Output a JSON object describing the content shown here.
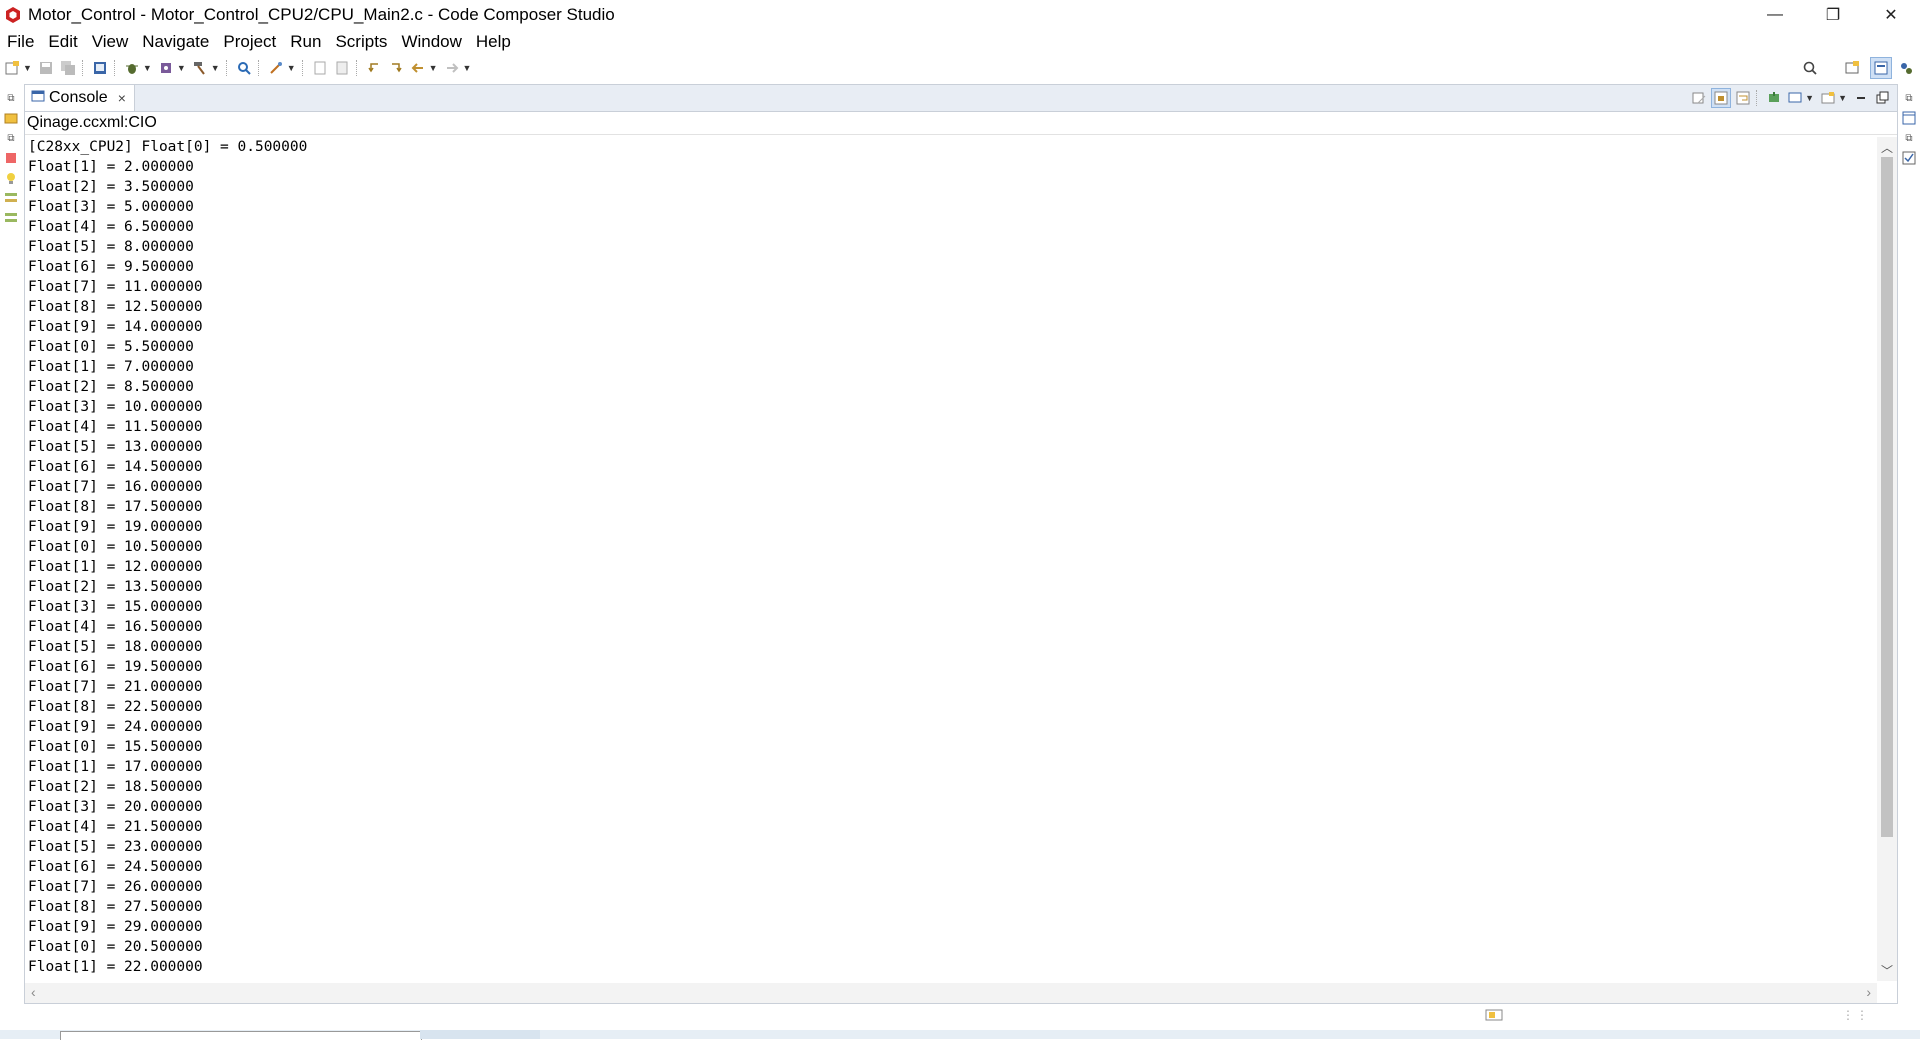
{
  "window": {
    "title": "Motor_Control - Motor_Control_CPU2/CPU_Main2.c - Code Composer Studio",
    "minimize": "—",
    "restore": "❐",
    "close": "✕"
  },
  "menu": [
    {
      "label": "File"
    },
    {
      "label": "Edit"
    },
    {
      "label": "View"
    },
    {
      "label": "Navigate"
    },
    {
      "label": "Project"
    },
    {
      "label": "Run"
    },
    {
      "label": "Scripts"
    },
    {
      "label": "Window"
    },
    {
      "label": "Help"
    }
  ],
  "console": {
    "tab_label": "Console",
    "tab_close": "×",
    "subtitle": "Qinage.ccxml:CIO",
    "lines": [
      "[C28xx_CPU2] Float[0] = 0.500000",
      "Float[1] = 2.000000",
      "Float[2] = 3.500000",
      "Float[3] = 5.000000",
      "Float[4] = 6.500000",
      "Float[5] = 8.000000",
      "Float[6] = 9.500000",
      "Float[7] = 11.000000",
      "Float[8] = 12.500000",
      "Float[9] = 14.000000",
      "Float[0] = 5.500000",
      "Float[1] = 7.000000",
      "Float[2] = 8.500000",
      "Float[3] = 10.000000",
      "Float[4] = 11.500000",
      "Float[5] = 13.000000",
      "Float[6] = 14.500000",
      "Float[7] = 16.000000",
      "Float[8] = 17.500000",
      "Float[9] = 19.000000",
      "Float[0] = 10.500000",
      "Float[1] = 12.000000",
      "Float[2] = 13.500000",
      "Float[3] = 15.000000",
      "Float[4] = 16.500000",
      "Float[5] = 18.000000",
      "Float[6] = 19.500000",
      "Float[7] = 21.000000",
      "Float[8] = 22.500000",
      "Float[9] = 24.000000",
      "Float[0] = 15.500000",
      "Float[1] = 17.000000",
      "Float[2] = 18.500000",
      "Float[3] = 20.000000",
      "Float[4] = 21.500000",
      "Float[5] = 23.000000",
      "Float[6] = 24.500000",
      "Float[7] = 26.000000",
      "Float[8] = 27.500000",
      "Float[9] = 29.000000",
      "Float[0] = 20.500000",
      "Float[1] = 22.000000"
    ]
  },
  "colors": {
    "app_icon": "#cc2222",
    "tab_bar": "#e8edf4",
    "scroll_thumb": "#c2c2c2"
  }
}
